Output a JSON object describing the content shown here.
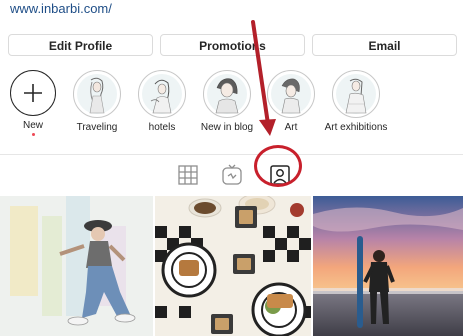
{
  "browser": {
    "url": "www.inbarbi.com/"
  },
  "actions": {
    "edit": "Edit Profile",
    "promotions": "Promotions",
    "email": "Email"
  },
  "highlights": [
    {
      "label": "New"
    },
    {
      "label": "Traveling"
    },
    {
      "label": "hotels"
    },
    {
      "label": "New in blog"
    },
    {
      "label": "Art"
    },
    {
      "label": "Art exhibitions"
    }
  ],
  "tabs": {
    "active": "tagged"
  },
  "colors": {
    "annotation": "#c8202c",
    "link": "#1f4e87",
    "notification_dot": "#ed4956"
  }
}
